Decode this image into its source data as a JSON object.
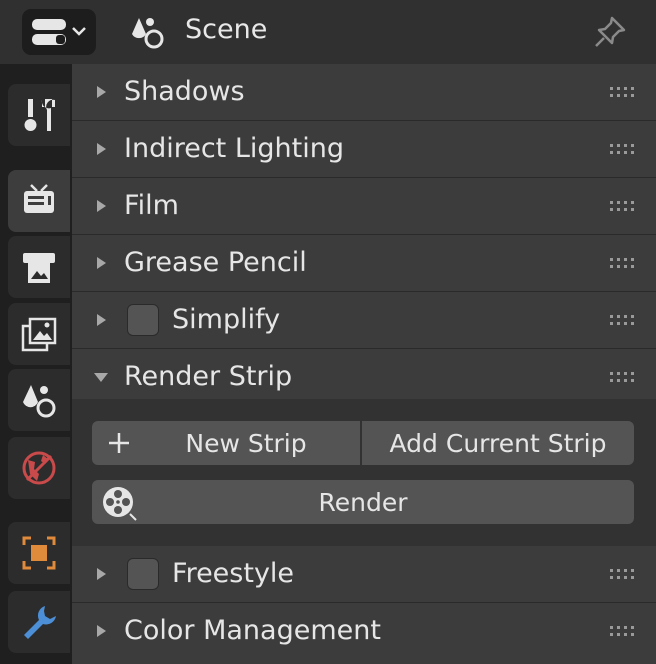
{
  "header": {
    "title": "Scene",
    "editor_type_icon": "properties-editor-icon",
    "pin_icon": "pin-icon"
  },
  "tabs": [
    {
      "name": "tool-tab",
      "icon": "tool-icon"
    },
    {
      "name": "render-tab",
      "icon": "render-icon",
      "active": true
    },
    {
      "name": "output-tab",
      "icon": "output-icon"
    },
    {
      "name": "view-layer-tab",
      "icon": "view-layer-icon"
    },
    {
      "name": "scene-tab",
      "icon": "scene-icon"
    },
    {
      "name": "world-tab",
      "icon": "world-icon"
    },
    {
      "name": "object-tab",
      "icon": "object-icon"
    },
    {
      "name": "modifier-tab",
      "icon": "wrench-icon"
    }
  ],
  "sections": {
    "shadows": "Shadows",
    "indirect_lighting": "Indirect Lighting",
    "film": "Film",
    "grease_pencil": "Grease Pencil",
    "simplify": "Simplify",
    "render_strip": "Render Strip",
    "freestyle": "Freestyle",
    "color_management": "Color Management"
  },
  "render_strip": {
    "new_strip_label": "New Strip",
    "new_strip_icon": "plus-icon",
    "add_current_label": "Add Current Strip",
    "render_label": "Render",
    "render_icon": "film-reel-icon"
  },
  "colors": {
    "accent_world": "#c94a4a",
    "accent_object": "#e08a3c",
    "accent_modifier": "#4c8fd6"
  }
}
